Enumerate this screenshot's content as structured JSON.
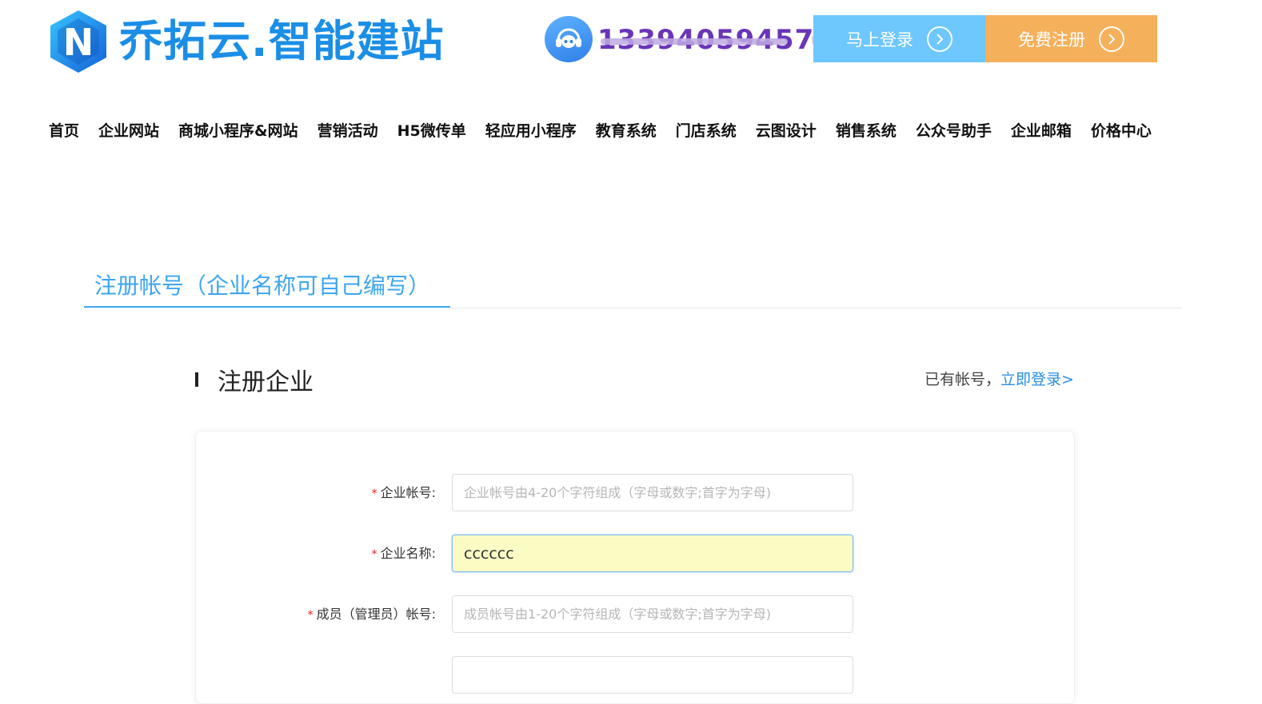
{
  "brand": {
    "name": "乔拓云.智能建站",
    "logo_letter": "N",
    "color": "#1b8ee6"
  },
  "contact": {
    "phone": "13394059457",
    "icon": "headset-icon"
  },
  "header_buttons": {
    "login_label": "马上登录",
    "register_label": "免费注册",
    "login_color": "#6ec7fd",
    "register_color": "#f5b05b"
  },
  "nav": {
    "items": [
      "首页",
      "企业网站",
      "商城小程序&网站",
      "营销活动",
      "H5微传单",
      "轻应用小程序",
      "教育系统",
      "门店系统",
      "云图设计",
      "销售系统",
      "公众号助手",
      "企业邮箱",
      "价格中心"
    ]
  },
  "tab": {
    "label": "注册帐号（企业名称可自己编写）",
    "color": "#3ea6ee"
  },
  "section": {
    "title": "注册企业",
    "has_account_text": "已有帐号，",
    "login_link": "立即登录>"
  },
  "form": {
    "fields": [
      {
        "label": "企业帐号:",
        "required": true,
        "value": "",
        "placeholder": "企业帐号由4-20个字符组成（字母或数字;首字为字母)"
      },
      {
        "label": "企业名称:",
        "required": true,
        "value": "cccccc",
        "placeholder": ""
      },
      {
        "label": "成员（管理员）帐号:",
        "required": true,
        "value": "",
        "placeholder": "成员帐号由1-20个字符组成（字母或数字;首字为字母)"
      }
    ],
    "required_mark": "*"
  }
}
